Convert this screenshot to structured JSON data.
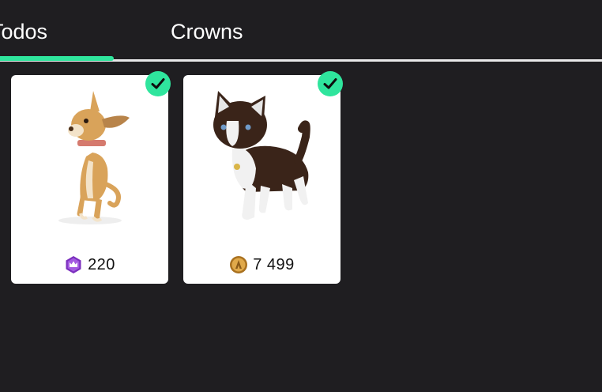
{
  "tabs": [
    {
      "label": "Todos",
      "active": true
    },
    {
      "label": "Crowns",
      "active": false
    }
  ],
  "items": [
    {
      "image_icon": "chihuahua-dog-icon",
      "owned": true,
      "currency_icon": "crown-currency-icon",
      "price": "220"
    },
    {
      "image_icon": "black-white-cat-icon",
      "owned": true,
      "currency_icon": "coin-currency-icon",
      "price": "7 499"
    }
  ],
  "colors": {
    "background": "#1f1e21",
    "accent": "#2fe59d",
    "card": "#ffffff",
    "crown_purple": "#7b2fbe",
    "coin_gold": "#c98a2e"
  }
}
